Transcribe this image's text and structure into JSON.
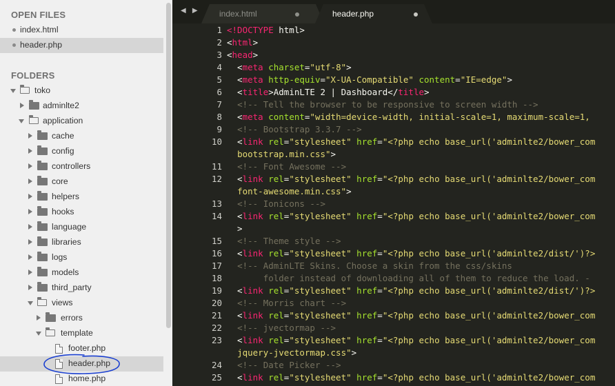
{
  "sidebar": {
    "open_files_heading": "OPEN FILES",
    "open_files": [
      {
        "label": "index.html"
      },
      {
        "label": "header.php"
      }
    ],
    "folders_heading": "FOLDERS",
    "tree": [
      {
        "label": "toko"
      },
      {
        "label": "adminlte2"
      },
      {
        "label": "application"
      },
      {
        "label": "cache"
      },
      {
        "label": "config"
      },
      {
        "label": "controllers"
      },
      {
        "label": "core"
      },
      {
        "label": "helpers"
      },
      {
        "label": "hooks"
      },
      {
        "label": "language"
      },
      {
        "label": "libraries"
      },
      {
        "label": "logs"
      },
      {
        "label": "models"
      },
      {
        "label": "third_party"
      },
      {
        "label": "views"
      },
      {
        "label": "errors"
      },
      {
        "label": "template"
      },
      {
        "label": "footer.php"
      },
      {
        "label": "header.php"
      },
      {
        "label": "home.php"
      }
    ]
  },
  "tabs": [
    {
      "label": "index.html"
    },
    {
      "label": "header.php"
    }
  ],
  "tab_nav": "◀ ▶",
  "editor": {
    "line_numbers": [
      "1",
      "2",
      "3",
      "4",
      "5",
      "6",
      "7",
      "8",
      "9",
      "10",
      "11",
      "12",
      "13",
      "14",
      "15",
      "16",
      "17",
      "18",
      "19",
      "20",
      "21",
      "22",
      "23",
      "24",
      "25"
    ],
    "lines": [
      {
        "html": "<span class=\"tag\">&lt;!DOCTYPE</span><span class=\"ws\"> html&gt;</span>"
      },
      {
        "html": "&lt;<span class=\"tag\">html</span>&gt;"
      },
      {
        "html": "&lt;<span class=\"tag\">head</span>&gt;"
      },
      {
        "html": "  &lt;<span class=\"tag\">meta</span> <span class=\"attr\">charset</span>=<span class=\"str\">\"utf-8\"</span>&gt;"
      },
      {
        "html": "  &lt;<span class=\"tag\">meta</span> <span class=\"attr\">http-equiv</span>=<span class=\"str\">\"X-UA-Compatible\"</span> <span class=\"attr\">content</span>=<span class=\"str\">\"IE=edge\"</span>&gt;"
      },
      {
        "html": "  &lt;<span class=\"tag\">title</span>&gt;AdminLTE 2 | Dashboard&lt;/<span class=\"tag\">title</span>&gt;"
      },
      {
        "html": "  <span class=\"cmt\">&lt;!-- Tell the browser to be responsive to screen width --&gt;</span>"
      },
      {
        "html": "  &lt;<span class=\"tag\">meta</span> <span class=\"attr\">content</span>=<span class=\"str\">\"width=device-width, initial-scale=1, maximum-scale=1,</span>"
      },
      {
        "html": "  <span class=\"cmt\">&lt;!-- Bootstrap 3.3.7 --&gt;</span>"
      },
      {
        "html": "  &lt;<span class=\"tag\">link</span> <span class=\"attr\">rel</span>=<span class=\"str\">\"stylesheet\"</span> <span class=\"attr\">href</span>=<span class=\"str\">\"&lt;?php echo base_url('adminlte2/bower_com</span>"
      },
      {
        "html": "  <span class=\"str\">bootstrap.min.css\"</span>&gt;"
      },
      {
        "html": "  <span class=\"cmt\">&lt;!-- Font Awesome --&gt;</span>"
      },
      {
        "html": "  &lt;<span class=\"tag\">link</span> <span class=\"attr\">rel</span>=<span class=\"str\">\"stylesheet\"</span> <span class=\"attr\">href</span>=<span class=\"str\">\"&lt;?php echo base_url('adminlte2/bower_com</span>"
      },
      {
        "html": "  <span class=\"str\">font-awesome.min.css\"</span>&gt;"
      },
      {
        "html": "  <span class=\"cmt\">&lt;!-- Ionicons --&gt;</span>"
      },
      {
        "html": "  &lt;<span class=\"tag\">link</span> <span class=\"attr\">rel</span>=<span class=\"str\">\"stylesheet\"</span> <span class=\"attr\">href</span>=<span class=\"str\">\"&lt;?php echo base_url('adminlte2/bower_com</span>"
      },
      {
        "html": "  &gt;"
      },
      {
        "html": "  <span class=\"cmt\">&lt;!-- Theme style --&gt;</span>"
      },
      {
        "html": "  &lt;<span class=\"tag\">link</span> <span class=\"attr\">rel</span>=<span class=\"str\">\"stylesheet\"</span> <span class=\"attr\">href</span>=<span class=\"str\">\"&lt;?php echo base_url('adminlte2/dist/')?&gt;</span>"
      },
      {
        "html": "  <span class=\"cmt\">&lt;!-- AdminLTE Skins. Choose a skin from the css/skins</span>"
      },
      {
        "html": "  <span class=\"cmt\">     folder instead of downloading all of them to reduce the load. -</span>"
      },
      {
        "html": "  &lt;<span class=\"tag\">link</span> <span class=\"attr\">rel</span>=<span class=\"str\">\"stylesheet\"</span> <span class=\"attr\">href</span>=<span class=\"str\">\"&lt;?php echo base_url('adminlte2/dist/')?&gt;</span>"
      },
      {
        "html": "  <span class=\"cmt\">&lt;!-- Morris chart --&gt;</span>"
      },
      {
        "html": "  &lt;<span class=\"tag\">link</span> <span class=\"attr\">rel</span>=<span class=\"str\">\"stylesheet\"</span> <span class=\"attr\">href</span>=<span class=\"str\">\"&lt;?php echo base_url('adminlte2/bower_com</span>"
      },
      {
        "html": "  <span class=\"cmt\">&lt;!-- jvectormap --&gt;</span>"
      },
      {
        "html": "  &lt;<span class=\"tag\">link</span> <span class=\"attr\">rel</span>=<span class=\"str\">\"stylesheet\"</span> <span class=\"attr\">href</span>=<span class=\"str\">\"&lt;?php echo base_url('adminlte2/bower_com</span>"
      },
      {
        "html": "  <span class=\"str\">jquery-jvectormap.css\"</span>&gt;"
      },
      {
        "html": "  <span class=\"cmt\">&lt;!-- Date Picker --&gt;</span>"
      },
      {
        "html": "  &lt;<span class=\"tag\">link</span> <span class=\"attr\">rel</span>=<span class=\"str\">\"stylesheet\"</span> <span class=\"attr\">href</span>=<span class=\"str\">\"&lt;?php echo base_url('adminlte2/bower_com</span>"
      }
    ]
  },
  "colors": {
    "editor_bg": "#23241f",
    "tag": "#f92672",
    "attr": "#a6e22e",
    "string": "#e6db74",
    "comment": "#75715e",
    "annotation": "#1a3fd0"
  }
}
